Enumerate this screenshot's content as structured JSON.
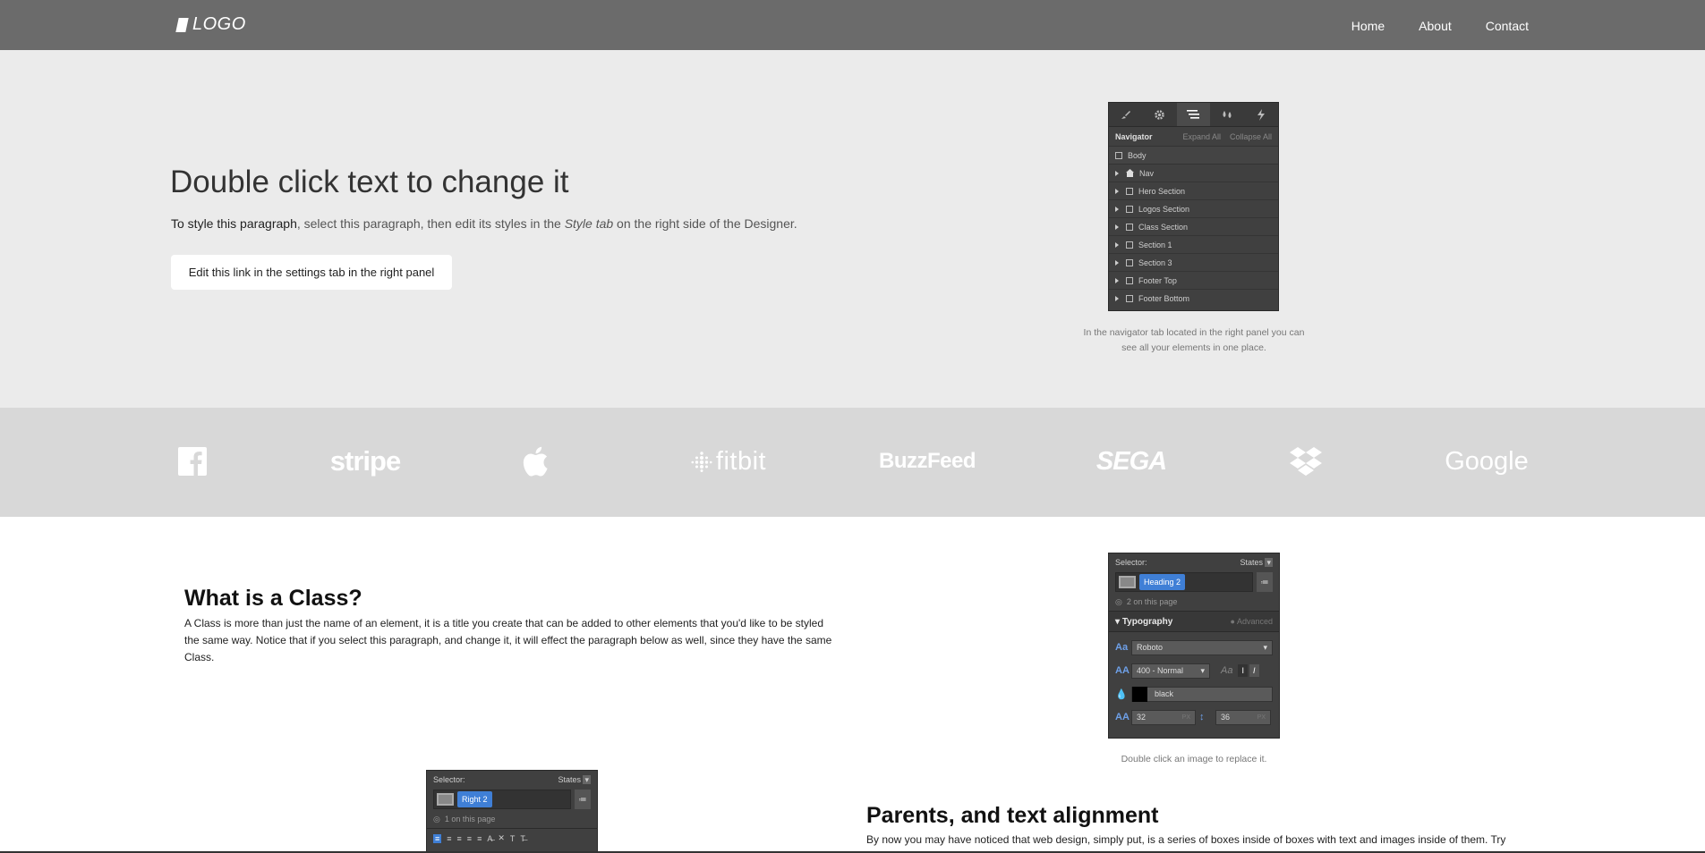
{
  "nav": {
    "logo_text": "LOGO",
    "links": [
      "Home",
      "About",
      "Contact"
    ]
  },
  "hero": {
    "title": "Double click text to change it",
    "para_bold": "To style this paragraph",
    "para_mid": ", select this paragraph, then edit its styles in the ",
    "para_italic": "Style tab",
    "para_end": " on the right side of the Designer.",
    "button_label": "Edit this link in the settings tab in the right panel",
    "caption": "In the navigator tab located in the right panel you can see all your elements in one place."
  },
  "navigator": {
    "title": "Navigator",
    "expand_all": "Expand All",
    "collapse_all": "Collapse All",
    "body_label": "Body",
    "items": [
      "Nav",
      "Hero Section",
      "Logos Section",
      "Class Section",
      "Section 1",
      "Section 3",
      "Footer Top",
      "Footer Bottom"
    ],
    "tab_icons": [
      "brush-icon",
      "gear-icon",
      "navigator-icon",
      "drops-icon",
      "lightning-icon"
    ]
  },
  "logos": [
    "facebook",
    "stripe",
    "apple",
    "fitbit",
    "BuzzFeed",
    "SEGA",
    "dropbox",
    "Google"
  ],
  "class_section": {
    "title": "What is a Class?",
    "paragraph": "A Class is more than just the name of an element, it is a title you create that can be added to other elements that you'd like to be styled the same way. Notice that if you select this paragraph, and change it, it will effect the paragraph below as well, since they have the same Class.",
    "caption": "Double click an image to replace it."
  },
  "selector_panel_1": {
    "selector_label": "Selector:",
    "states_label": "States",
    "chip": "Heading 2",
    "count": "2 on this page",
    "section": "Typography",
    "advanced": "Advanced",
    "font": "Roboto",
    "weight": "400 - Normal",
    "color_name": "black",
    "font_size": "32",
    "line_height": "36",
    "unit": "PX"
  },
  "selector_panel_2": {
    "selector_label": "Selector:",
    "states_label": "States",
    "chip": "Right 2",
    "count": "1 on this page"
  },
  "parents_section": {
    "title": "Parents, and text alignment",
    "paragraph": "By now you may have noticed that web design, simply put, is a series of boxes inside of boxes with text and images inside of them. Try"
  }
}
